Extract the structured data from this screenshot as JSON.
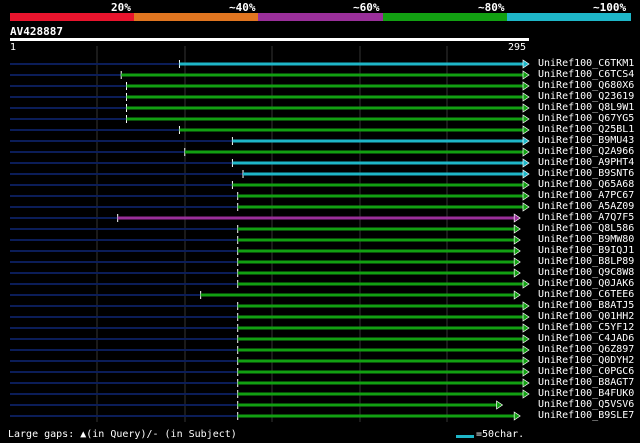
{
  "scale": {
    "segments": [
      "#e8142d",
      "#e07520",
      "#9a2f9a",
      "#12a012",
      "#1eb6c8"
    ],
    "labels": [
      "20%",
      "~40%",
      "~60%",
      "~80%",
      "~100%"
    ]
  },
  "query": {
    "id": "AV428887",
    "start": "1",
    "end": "295",
    "length": 295
  },
  "colors": {
    "query_bar": "#ffffff",
    "background": "#000000",
    "grid": "#333333",
    "unaligned": "#0b1d58"
  },
  "hits": [
    {
      "label": "UniRef100_C6TKM1",
      "start": 97,
      "end": 295,
      "color": "#1eb6c8"
    },
    {
      "label": "UniRef100_C6TCS4",
      "start": 64,
      "end": 295,
      "color": "#12a012"
    },
    {
      "label": "UniRef100_Q680X6",
      "start": 67,
      "end": 295,
      "color": "#12a012"
    },
    {
      "label": "UniRef100_Q23619",
      "start": 67,
      "end": 295,
      "color": "#12a012"
    },
    {
      "label": "UniRef100_Q8L9W1",
      "start": 67,
      "end": 295,
      "color": "#12a012"
    },
    {
      "label": "UniRef100_Q67YG5",
      "start": 67,
      "end": 295,
      "color": "#12a012"
    },
    {
      "label": "UniRef100_Q25BL1",
      "start": 97,
      "end": 295,
      "color": "#12a012"
    },
    {
      "label": "UniRef100_B9MU43",
      "start": 127,
      "end": 295,
      "color": "#1eb6c8"
    },
    {
      "label": "UniRef100_Q2A966",
      "start": 100,
      "end": 295,
      "color": "#12a012"
    },
    {
      "label": "UniRef100_A9PHT4",
      "start": 127,
      "end": 295,
      "color": "#1eb6c8"
    },
    {
      "label": "UniRef100_B9SNT6",
      "start": 133,
      "end": 295,
      "color": "#1eb6c8"
    },
    {
      "label": "UniRef100_Q65A68",
      "start": 127,
      "end": 295,
      "color": "#12a012"
    },
    {
      "label": "UniRef100_A7PC67",
      "start": 130,
      "end": 295,
      "color": "#12a012"
    },
    {
      "label": "UniRef100_A5AZ09",
      "start": 130,
      "end": 295,
      "color": "#12a012"
    },
    {
      "label": "UniRef100_A7Q7F5",
      "start": 62,
      "end": 290,
      "color": "#9a2f9a"
    },
    {
      "label": "UniRef100_Q8L586",
      "start": 130,
      "end": 290,
      "color": "#12a012"
    },
    {
      "label": "UniRef100_B9MW80",
      "start": 130,
      "end": 290,
      "color": "#12a012"
    },
    {
      "label": "UniRef100_B9IQJ1",
      "start": 130,
      "end": 290,
      "color": "#12a012"
    },
    {
      "label": "UniRef100_B8LP89",
      "start": 130,
      "end": 290,
      "color": "#12a012"
    },
    {
      "label": "UniRef100_Q9C8W8",
      "start": 130,
      "end": 290,
      "color": "#12a012"
    },
    {
      "label": "UniRef100_Q0JAK6",
      "start": 130,
      "end": 295,
      "color": "#12a012"
    },
    {
      "label": "UniRef100_C6TEE6",
      "start": 109,
      "end": 290,
      "color": "#12a012"
    },
    {
      "label": "UniRef100_B8ATJ5",
      "start": 130,
      "end": 295,
      "color": "#12a012"
    },
    {
      "label": "UniRef100_Q01HH2",
      "start": 130,
      "end": 295,
      "color": "#12a012"
    },
    {
      "label": "UniRef100_C5YF12",
      "start": 130,
      "end": 295,
      "color": "#12a012"
    },
    {
      "label": "UniRef100_C4JAD6",
      "start": 130,
      "end": 295,
      "color": "#12a012"
    },
    {
      "label": "UniRef100_Q6Z897",
      "start": 130,
      "end": 295,
      "color": "#12a012"
    },
    {
      "label": "UniRef100_Q0DYH2",
      "start": 130,
      "end": 295,
      "color": "#12a012"
    },
    {
      "label": "UniRef100_C0PGC6",
      "start": 130,
      "end": 295,
      "color": "#12a012"
    },
    {
      "label": "UniRef100_B8AGT7",
      "start": 130,
      "end": 295,
      "color": "#12a012"
    },
    {
      "label": "UniRef100_B4FUK0",
      "start": 130,
      "end": 295,
      "color": "#12a012"
    },
    {
      "label": "UniRef100_Q5VSV6",
      "start": 130,
      "end": 280,
      "color": "#12a012"
    },
    {
      "label": "UniRef100_B9SLE7",
      "start": 130,
      "end": 290,
      "color": "#12a012"
    }
  ],
  "footer": {
    "text": "Large gaps: ▲(in Query)/- (in Subject)",
    "legend": "=50char.",
    "legend_color": "#1eb6c8"
  }
}
